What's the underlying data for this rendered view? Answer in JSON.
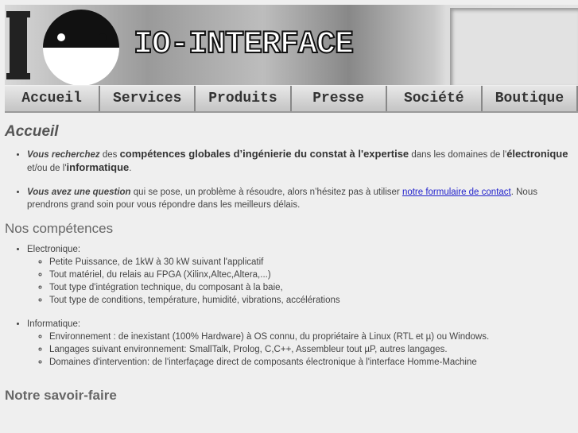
{
  "header": {
    "site_title": "IO-INTERFACE",
    "logo_text": "IO"
  },
  "nav": [
    "Accueil",
    "Services",
    "Produits",
    "Presse",
    "Société",
    "Boutique"
  ],
  "page_title": "Accueil",
  "intro": [
    {
      "em": "Vous recherchez",
      "t1": " des ",
      "strong1": "compétences globales d’ingénierie du constat à l'expertise",
      "t2": " dans les domaines de l'",
      "strong2": "électronique",
      "t3": " et/ou de l'",
      "strong3": "informatique",
      "t4": "."
    },
    {
      "em": "Vous avez une question",
      "t1": " qui se pose, un problème à résoudre, alors n’hésitez pas à utiliser ",
      "link": "notre formulaire de contact",
      "t2": ". Nous prendrons grand soin pour vous  répondre dans les meilleurs délais."
    }
  ],
  "competences": {
    "title": "Nos compétences",
    "groups": [
      {
        "label": "Electronique:",
        "items": [
          "Petite Puissance, de 1kW à 30 kW suivant l'applicatif",
          "Tout matériel, du relais au FPGA (Xilinx,Altec,Altera,...)",
          "Tout type d'intégration technique, du composant à la baie,",
          "Tout type de conditions, température, humidité, vibrations, accélérations"
        ]
      },
      {
        "label": "Informatique:",
        "items": [
          "Environnement : de inexistant (100% Hardware) à OS connu, du propriétaire à Linux (RTL et µ) ou Windows.",
          "Langages suivant environnement: SmallTalk, Prolog, C,C++, Assembleur tout µP, autres langages.",
          "Domaines d'intervention: de l'interfaçage direct de composants électronique à l'interface Homme-Machine"
        ]
      }
    ]
  },
  "savoir_faire": {
    "title": "Notre savoir-faire"
  }
}
